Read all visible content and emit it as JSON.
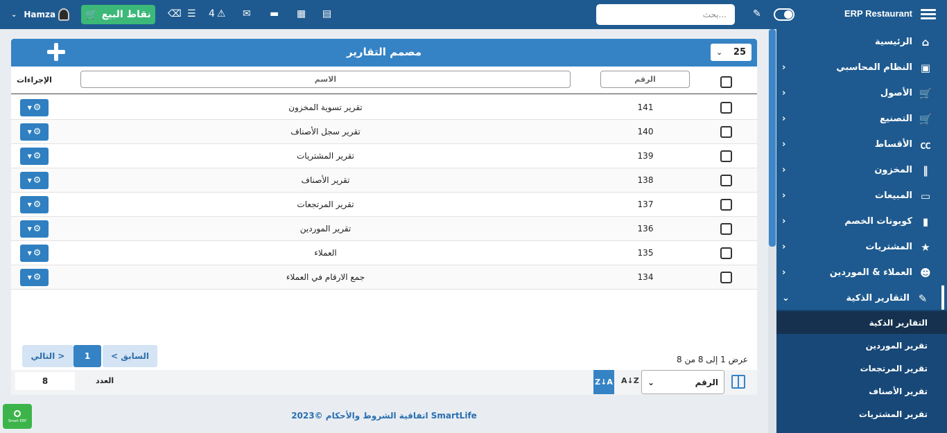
{
  "topbar": {
    "user": "Hamza",
    "pos_label": "نقاط البيع",
    "alerts_count": "4",
    "search_placeholder": "بحث...",
    "brand": "ERP Restaurant"
  },
  "sidebar": {
    "items": [
      {
        "label": "الرئيسية",
        "icon": "home-icon",
        "glyph": "⌂",
        "arrow": ""
      },
      {
        "label": "النظام المحاسبي",
        "icon": "money-icon",
        "glyph": "▣",
        "arrow": "›"
      },
      {
        "label": "الأصول",
        "icon": "cart-icon",
        "glyph": "🛒",
        "arrow": "›"
      },
      {
        "label": "التصنيع",
        "icon": "cart-icon",
        "glyph": "🛒",
        "arrow": "›"
      },
      {
        "label": "الأقساط",
        "icon": "cc-icon",
        "glyph": "㏄",
        "arrow": "›"
      },
      {
        "label": "المخزون",
        "icon": "barcode-icon",
        "glyph": "‖",
        "arrow": "›"
      },
      {
        "label": "المبيعات",
        "icon": "credit-card-icon",
        "glyph": "▭",
        "arrow": "›"
      },
      {
        "label": "كوبونات الخصم",
        "icon": "bookmark-icon",
        "glyph": "▮",
        "arrow": "›"
      },
      {
        "label": "المشتريات",
        "icon": "star-icon",
        "glyph": "★",
        "arrow": "›"
      },
      {
        "label": "العملاء & الموردين",
        "icon": "users-icon",
        "glyph": "☻",
        "arrow": "›"
      },
      {
        "label": "التقارير الذكية",
        "icon": "brush-icon",
        "glyph": "✎",
        "arrow": "⌄"
      }
    ],
    "submenu": [
      "التقارير الذكية",
      "تقرير الموردين",
      "تقرير المرتجعات",
      "تقرير الأصناف",
      "تقرير المشتريات"
    ]
  },
  "panel": {
    "title": "مصمم التقارير",
    "page_size": "25",
    "filters": {
      "number": "الرقم",
      "name": "الاسم",
      "actions": "الإجراءات"
    },
    "rows": [
      {
        "id": "141",
        "name": "تقرير تسوية المخزون"
      },
      {
        "id": "140",
        "name": "تقرير سجل الأصناف"
      },
      {
        "id": "139",
        "name": "تقرير المشتريات"
      },
      {
        "id": "138",
        "name": "تقرير الأصناف"
      },
      {
        "id": "137",
        "name": "تقرير المرتجعات"
      },
      {
        "id": "136",
        "name": "تقرير الموردين"
      },
      {
        "id": "135",
        "name": "العملاء"
      },
      {
        "id": "134",
        "name": "جمع الارقام في العملاء"
      }
    ],
    "pagination": {
      "prev": "< السابق",
      "current": "1",
      "next": "التالي >"
    },
    "showing": "عرض 1 إلى 8 من 8",
    "count_label": "العدد",
    "count_value": "8",
    "sort_field": "الرقم",
    "sort_desc": "Z↓A",
    "sort_asc": "A↓Z"
  },
  "footer": {
    "copyright_prefix": "©2023",
    "brand": "SmartLife",
    "terms": "اتفاقية الشروط والأحكام",
    "badge": "Smart ERP"
  }
}
